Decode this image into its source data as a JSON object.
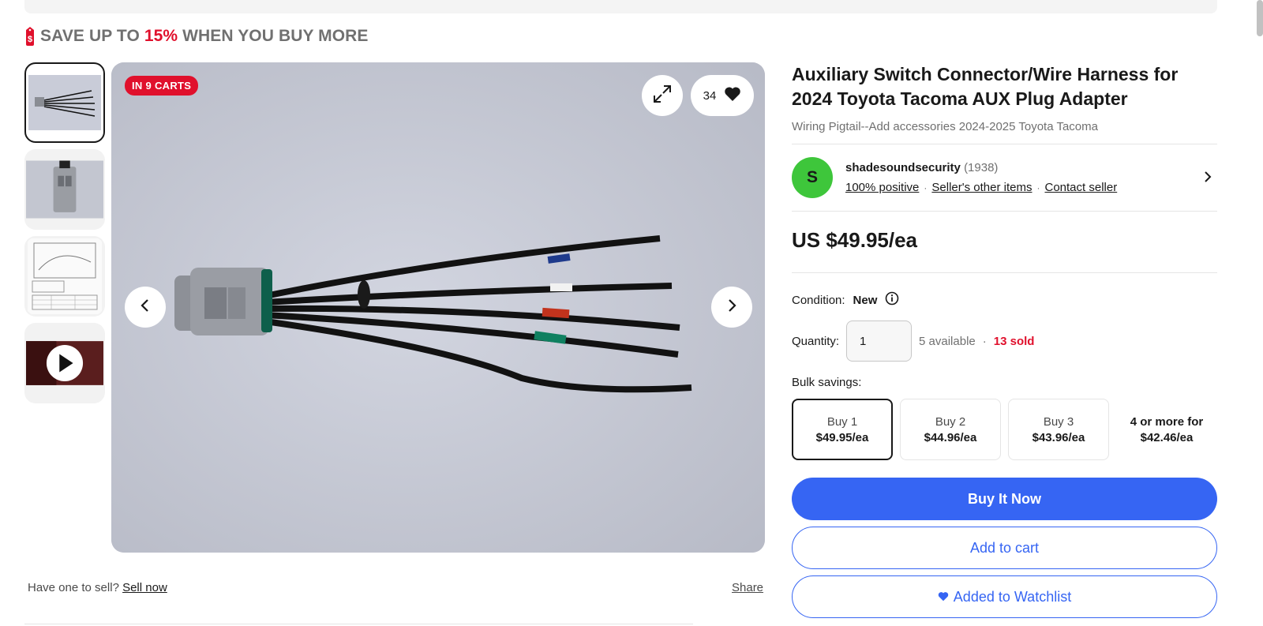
{
  "promo": {
    "prefix": "SAVE UP TO ",
    "percent": "15%",
    "suffix": " WHEN YOU BUY MORE"
  },
  "gallery": {
    "thumbnails": [
      {
        "name": "thumb-harness",
        "active": true
      },
      {
        "name": "thumb-connector"
      },
      {
        "name": "thumb-diagram"
      },
      {
        "name": "thumb-video"
      }
    ],
    "cart_badge": "IN 9 CARTS",
    "watch_count": "34"
  },
  "below_image": {
    "prompt": "Have one to sell? ",
    "sell_link": "Sell now",
    "share": "Share"
  },
  "listing": {
    "title": "Auxiliary Switch Connector/Wire Harness for 2024 Toyota Tacoma AUX Plug Adapter",
    "subtitle": "Wiring Pigtail--Add accessories 2024-2025 Toyota Tacoma"
  },
  "seller": {
    "initial": "S",
    "name": "shadesoundsecurity",
    "feedback_count": "(1938)",
    "positive": "100% positive",
    "other_items": "Seller's other items",
    "contact": "Contact seller"
  },
  "price": "US $49.95/ea",
  "condition": {
    "label": "Condition:",
    "value": "New"
  },
  "quantity": {
    "label": "Quantity:",
    "value": "1",
    "available": "5 available",
    "sold": "13 sold"
  },
  "bulk": {
    "label": "Bulk savings:",
    "options": [
      {
        "qty": "Buy 1",
        "price": "$49.95/ea"
      },
      {
        "qty": "Buy 2",
        "price": "$44.96/ea"
      },
      {
        "qty": "Buy 3",
        "price": "$43.96/ea"
      },
      {
        "qty": "4 or more for",
        "price": "$42.46/ea"
      }
    ]
  },
  "buttons": {
    "buy_now": "Buy It Now",
    "add_to_cart": "Add to cart",
    "watchlist": "Added to Watchlist"
  },
  "colors": {
    "accent_blue": "#3665f3",
    "alert_red": "#e0102c",
    "seller_green": "#3ec63b"
  }
}
